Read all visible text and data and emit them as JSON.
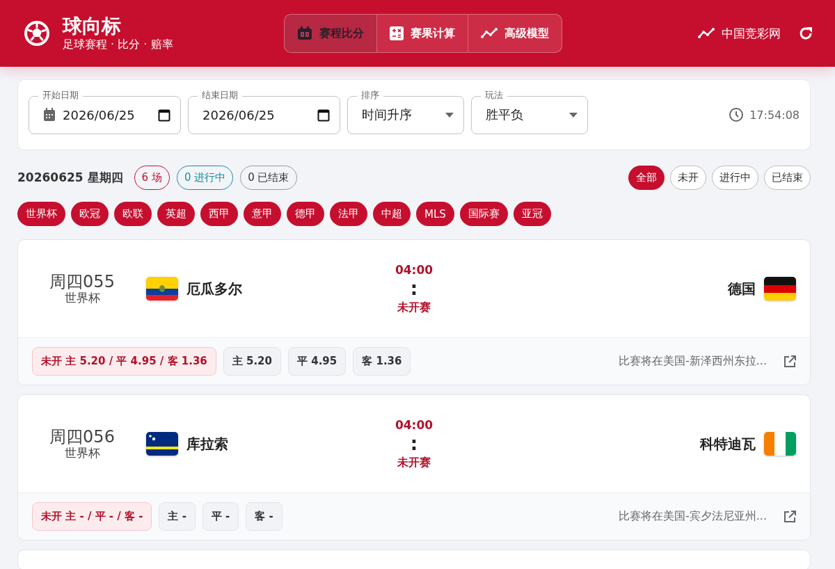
{
  "header": {
    "title": "球向标",
    "subtitle": "足球赛程 · 比分 · 赔率",
    "nav": [
      {
        "label": "赛程比分",
        "selected": true
      },
      {
        "label": "赛果计算",
        "selected": false
      },
      {
        "label": "高级模型",
        "selected": false
      }
    ],
    "link": "中国竞彩网"
  },
  "filters": {
    "fields": [
      {
        "kind": "date",
        "legend": "开始日期",
        "value": "2026/06/25"
      },
      {
        "kind": "date",
        "legend": "结束日期",
        "value": "2026/06/25"
      },
      {
        "kind": "select",
        "legend": "排序",
        "value": "时间升序"
      },
      {
        "kind": "select",
        "legend": "玩法",
        "value": "胜平负"
      }
    ],
    "clock": "17:54:08"
  },
  "summary": {
    "date": "20260625 星期四",
    "counts": [
      {
        "label": "6 场",
        "color": "#c8102e"
      },
      {
        "label": "0 进行中",
        "color": "#17909c"
      },
      {
        "label": "0 已结束",
        "color": "#9a9a9a"
      }
    ],
    "status_filters": [
      {
        "label": "全部",
        "selected": true
      },
      {
        "label": "未开",
        "selected": false
      },
      {
        "label": "进行中",
        "selected": false
      },
      {
        "label": "已结束",
        "selected": false
      }
    ]
  },
  "leagues": [
    "世界杯",
    "欧冠",
    "欧联",
    "英超",
    "西甲",
    "意甲",
    "德甲",
    "法甲",
    "中超",
    "MLS",
    "国际赛",
    "亚冠"
  ],
  "matches": [
    {
      "code": "周四055",
      "league": "世界杯",
      "home": "厄瓜多尔",
      "away": "德国",
      "time": "04:00",
      "separator": ":",
      "status": "未开赛",
      "odds_summary": "未开 主 5.20 / 平 4.95 / 客 1.36",
      "odds": [
        "主 5.20",
        "平 4.95",
        "客 1.36"
      ],
      "venue": "比赛将在美国-新泽西州东拉..."
    },
    {
      "code": "周四056",
      "league": "世界杯",
      "home": "库拉索",
      "away": "科特迪瓦",
      "time": "04:00",
      "separator": ":",
      "status": "未开赛",
      "odds_summary": "未开 主 - / 平 - / 客 -",
      "odds": [
        "主 -",
        "平 -",
        "客 -"
      ],
      "venue": "比赛将在美国-宾夕法尼亚州..."
    }
  ]
}
